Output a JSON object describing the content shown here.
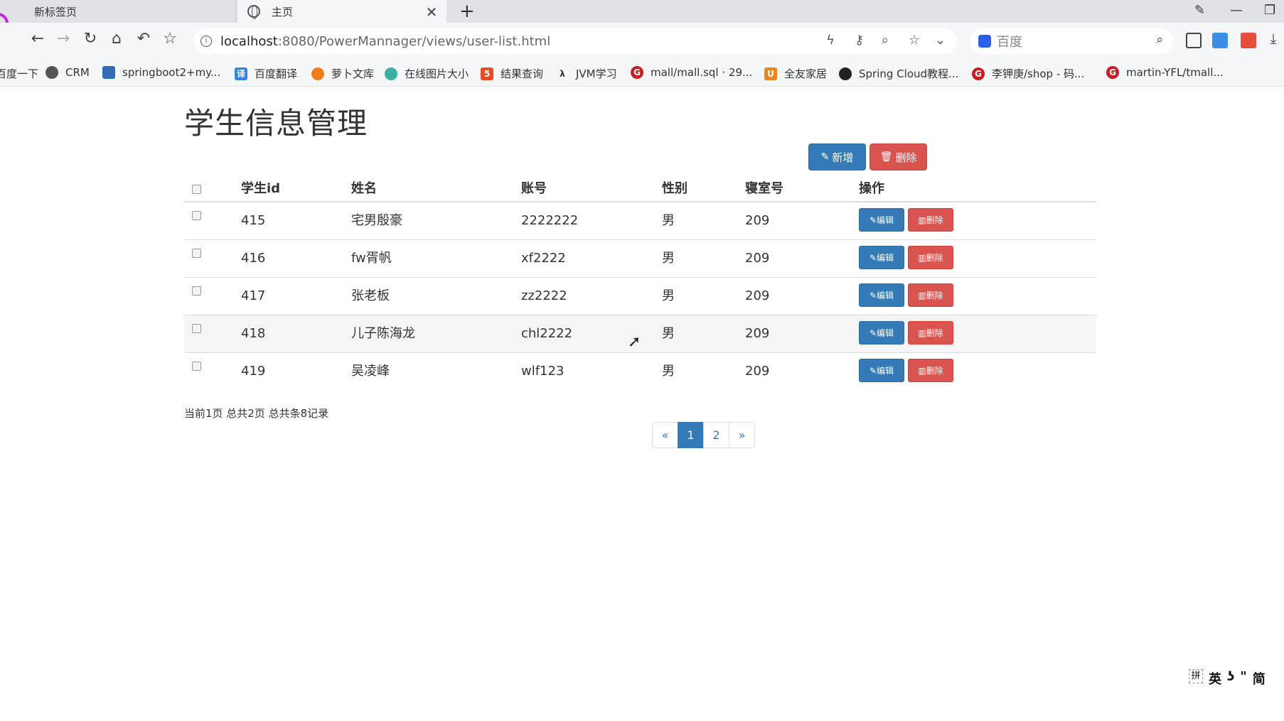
{
  "browser": {
    "tabs": [
      {
        "label": "新标签页",
        "active": false
      },
      {
        "label": "主页",
        "active": true
      }
    ],
    "url_host": "localhost",
    "url_path": ":8080/PowerMannager/views/user-list.html",
    "search_placeholder": "百度",
    "bookmarks": [
      {
        "label": "百度一下",
        "icon": "globe-icon"
      },
      {
        "label": "CRM",
        "icon": "globe-icon"
      },
      {
        "label": "springboot2+my...",
        "icon": "code-icon"
      },
      {
        "label": "百度翻译",
        "icon": "translate-icon"
      },
      {
        "label": "萝卜文库",
        "icon": "carrot-icon"
      },
      {
        "label": "在线图片大小",
        "icon": "gear-icon"
      },
      {
        "label": "结果查询",
        "icon": "html5-icon"
      },
      {
        "label": "JVM学习",
        "icon": "lambda-icon"
      },
      {
        "label": "mall/mall.sql · 29...",
        "icon": "gitee-icon"
      },
      {
        "label": "全友家居",
        "icon": "u-icon"
      },
      {
        "label": "Spring Cloud教程...",
        "icon": "github-icon"
      },
      {
        "label": "李钾庚/shop - 码...",
        "icon": "gitee-icon"
      },
      {
        "label": "martin-YFL/tmall...",
        "icon": "gitee-icon"
      }
    ]
  },
  "page": {
    "title": "学生信息管理",
    "add_label": "新增",
    "delete_label": "删除",
    "table": {
      "headers": [
        "学生id",
        "姓名",
        "账号",
        "性别",
        "寝室号",
        "操作"
      ],
      "rows": [
        {
          "id": "415",
          "name": "宅男殷豪",
          "account": "2222222",
          "gender": "男",
          "room": "209"
        },
        {
          "id": "416",
          "name": "fw胥帆",
          "account": "xf2222",
          "gender": "男",
          "room": "209"
        },
        {
          "id": "417",
          "name": "张老板",
          "account": "zz2222",
          "gender": "男",
          "room": "209"
        },
        {
          "id": "418",
          "name": "儿子陈海龙",
          "account": "chl2222",
          "gender": "男",
          "room": "209"
        },
        {
          "id": "419",
          "name": "吴凌峰",
          "account": "wlf123",
          "gender": "男",
          "room": "209"
        }
      ],
      "edit_label": "编辑",
      "row_delete_label": "删除"
    },
    "page_info": "当前1页 总共2页 总共条8记录",
    "pagination": {
      "prev": "«",
      "pages": [
        "1",
        "2"
      ],
      "next": "»",
      "current": "1"
    }
  },
  "ime": {
    "items": [
      "拼",
      "英",
      "ʖ",
      "\"",
      "简"
    ]
  },
  "colors": {
    "primary": "#337ab7",
    "danger": "#d9534f",
    "tabbar": "#dfe3e8",
    "toolbar": "#f4f6f8"
  }
}
